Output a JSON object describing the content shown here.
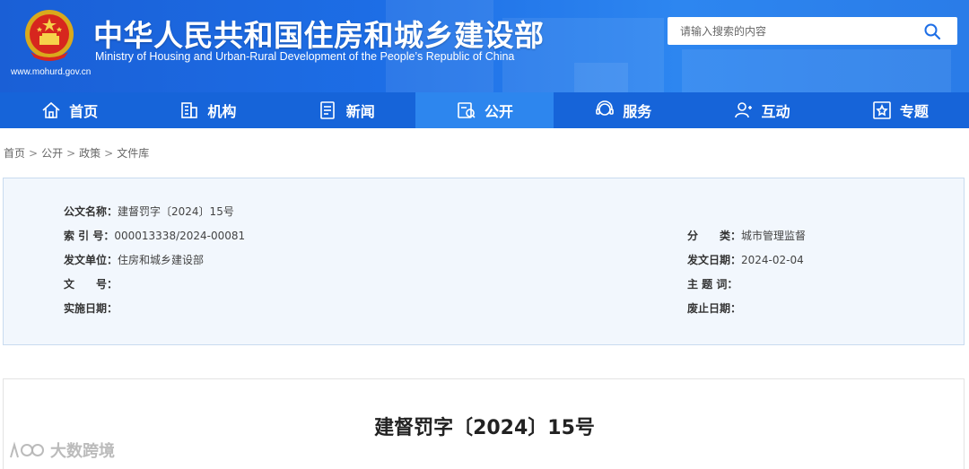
{
  "header": {
    "title": "中华人民共和国住房和城乡建设部",
    "subtitle": "Ministry of Housing and Urban-Rural Development of the People’s Republic of China",
    "url": "www.mohurd.gov.cn",
    "search_placeholder": "请输入搜索的内容"
  },
  "nav": [
    {
      "label": "首页",
      "icon": "home-icon"
    },
    {
      "label": "机构",
      "icon": "building-icon"
    },
    {
      "label": "新闻",
      "icon": "news-icon"
    },
    {
      "label": "公开",
      "icon": "folder-icon",
      "active": true
    },
    {
      "label": "服务",
      "icon": "service-icon"
    },
    {
      "label": "互动",
      "icon": "user-icon"
    },
    {
      "label": "专题",
      "icon": "star-icon"
    }
  ],
  "breadcrumb": [
    "首页",
    "公开",
    "政策",
    "文件库"
  ],
  "info": {
    "doc_name_label": "公文名称：",
    "doc_name": "建督罚字〔2024〕15号",
    "index_label": "索 引 号：",
    "index": "000013338/2024-00081",
    "category_label": "分　　类：",
    "category": "城市管理监督",
    "issuer_label": "发文单位：",
    "issuer": "住房和城乡建设部",
    "date_label": "发文日期：",
    "date": "2024-02-04",
    "docno_label": "文　　号：",
    "docno": "",
    "keywords_label": "主 题 词：",
    "keywords": "",
    "effective_label": "实施日期：",
    "effective": "",
    "expire_label": "废止日期：",
    "expire": ""
  },
  "document": {
    "title": "建督罚字〔2024〕15号"
  },
  "watermark": "大数跨境",
  "colors": {
    "header_blue": "#1d6ee6",
    "nav_blue": "#1664d9",
    "nav_active": "#2d86ee",
    "info_bg": "#f2f7fd"
  }
}
